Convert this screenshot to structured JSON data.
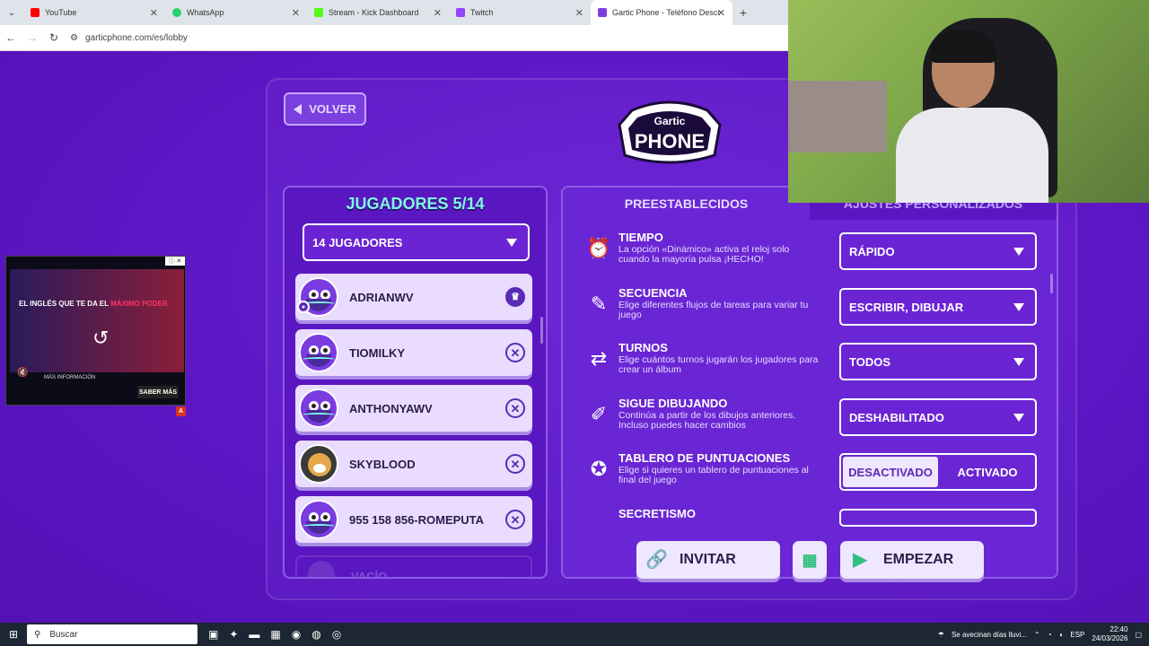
{
  "browser": {
    "tabs": [
      {
        "title": "YouTube",
        "color": "#ff0000"
      },
      {
        "title": "WhatsApp",
        "color": "#25d366"
      },
      {
        "title": "Stream - Kick Dashboard",
        "color": "#53fc18"
      },
      {
        "title": "Twitch",
        "color": "#9146ff"
      },
      {
        "title": "Gartic Phone - Teléfono Descon",
        "color": "#7b3fe0"
      }
    ],
    "url": "garticphone.com/es/lobby"
  },
  "lobby": {
    "back_label": "VOLVER",
    "logo_top": "Gartic",
    "logo_bottom": "PHONE",
    "players_title": "JUGADORES 5/14",
    "players_select": "14 JUGADORES",
    "players": [
      {
        "name": "ADRIANWV",
        "action": "♛"
      },
      {
        "name": "TIOMILKY",
        "action": "✕"
      },
      {
        "name": "ANTHONYAWV",
        "action": "✕"
      },
      {
        "name": "SKYBLOOD",
        "action": "✕"
      },
      {
        "name": "955 158 856-ROMEPUTA",
        "action": "✕"
      }
    ],
    "empty_label": "VACÍO"
  },
  "settings": {
    "tab_presets": "PREESTABLECIDOS",
    "tab_custom": "AJUSTES PERSONALIZADOS",
    "rows": [
      {
        "title": "TIEMPO",
        "desc": "La opción «Dinámico» activa el reloj solo cuando la mayoría pulsa ¡HECHO!",
        "value": "RÁPIDO",
        "icon": "⏰"
      },
      {
        "title": "SECUENCIA",
        "desc": "Elige diferentes flujos de tareas para variar tu juego",
        "value": "ESCRIBIR, DIBUJAR",
        "icon": "✎"
      },
      {
        "title": "TURNOS",
        "desc": "Elige cuántos turnos jugarán los jugadores para crear un álbum",
        "value": "TODOS",
        "icon": "⇄"
      },
      {
        "title": "SIGUE DIBUJANDO",
        "desc": "Continúa a partir de los dibujos anteriores. Incluso puedes hacer cambios",
        "value": "DESHABILITADO",
        "icon": "✐"
      },
      {
        "title": "TABLERO DE PUNTUACIONES",
        "desc": "Elige si quieres un tablero de puntuaciones al final del juego",
        "toggle_off": "DESACTIVADO",
        "toggle_on": "ACTIVADO",
        "icon": "✪"
      },
      {
        "title": "SECRETISMO"
      }
    ]
  },
  "actions": {
    "invite_label": "INVITAR",
    "start_label": "EMPEZAR"
  },
  "ad": {
    "headline": "EL INGLÉS QUE TE DA EL",
    "headline_em": "MÁXIMO PODER",
    "info": "MÁS INFORMACIÓN",
    "cta": "SABER MÁS",
    "badge": "A"
  },
  "taskbar": {
    "search": "Buscar",
    "weather": "Se avecinan días lluvi...",
    "lang": "ESP",
    "time": "22:40",
    "date": "24/03/2026"
  }
}
